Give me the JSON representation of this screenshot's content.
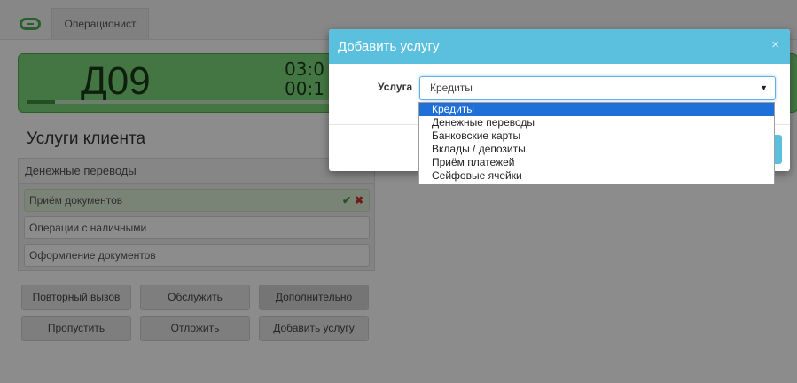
{
  "app": {
    "tab": "Операционист"
  },
  "ticket": {
    "number": "Д09",
    "timer1": "03:0",
    "timer2": "00:1",
    "progress_fraction": 0.08
  },
  "services": {
    "title": "Услуги клиента",
    "group": "Денежные переводы",
    "items": [
      {
        "label": "Приём документов",
        "active": true
      },
      {
        "label": "Операции с наличными",
        "active": false
      },
      {
        "label": "Оформление документов",
        "active": false
      }
    ]
  },
  "actions": {
    "row1": [
      "Повторный вызов",
      "Обслужить",
      "Дополнительно"
    ],
    "row2": [
      "Пропустить",
      "Отложить",
      "Добавить услугу"
    ]
  },
  "modal": {
    "title": "Добавить услугу",
    "close": "×",
    "field_label": "Услуга",
    "selected": "Кредиты",
    "options": [
      "Кредиты",
      "Денежные переводы",
      "Банковские карты",
      "Вклады / депозиты",
      "Приём платежей",
      "Сейфовые ячейки"
    ]
  },
  "colors": {
    "modal_header": "#5bc0de",
    "ticket_bg": "#7dd87d",
    "selected_option": "#1e70d8"
  }
}
